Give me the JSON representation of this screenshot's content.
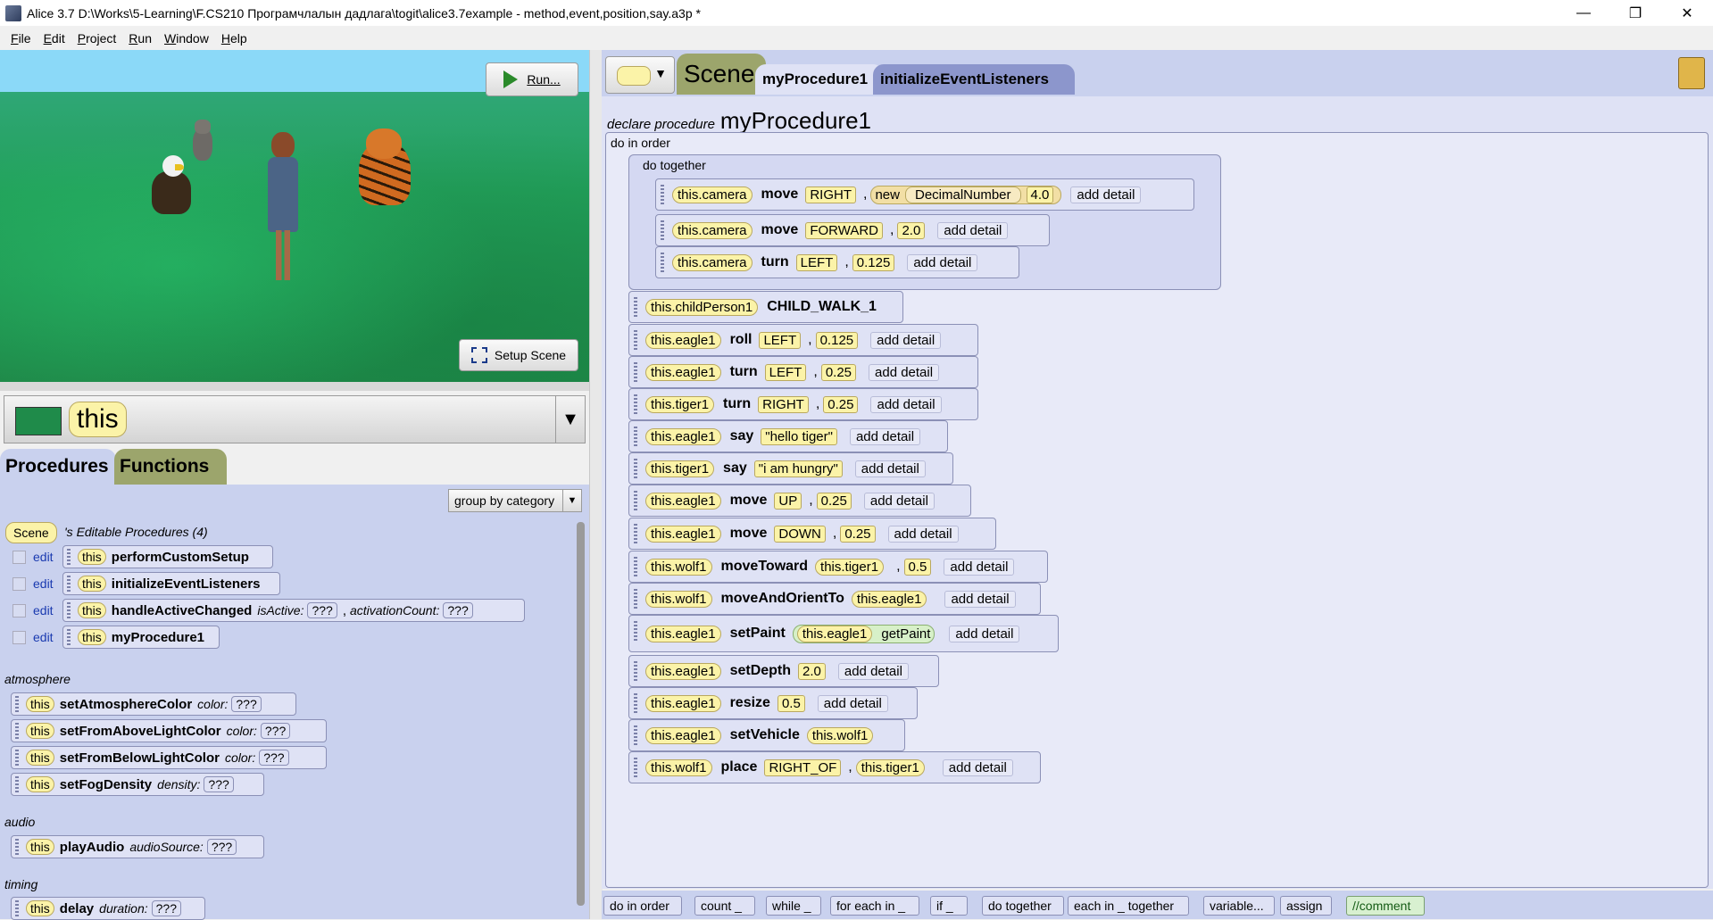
{
  "window": {
    "title": "Alice 3.7 D:\\Works\\5-Learning\\F.CS210 Програмчлалын дадлага\\togit\\alice3.7example - method,event,position,say.a3p *",
    "controls": [
      "—",
      "❐",
      "✕"
    ]
  },
  "menu": [
    "File",
    "Edit",
    "Project",
    "Run",
    "Window",
    "Help"
  ],
  "scene_view": {
    "run_label": "Run...",
    "setup_scene_label": "Setup Scene"
  },
  "instance_selector": {
    "value": "this"
  },
  "left_tabs": {
    "procedures": "Procedures",
    "functions": "Functions"
  },
  "group_by": "group by category",
  "editable": {
    "owner": "Scene",
    "caption": "'s Editable Procedures (4)",
    "edit_label": "edit",
    "this_label": "this",
    "unknown": "???",
    "items": [
      {
        "name": "performCustomSetup"
      },
      {
        "name": "initializeEventListeners"
      },
      {
        "name": "handleActiveChanged",
        "p1": "isActive:",
        "p2": "activationCount:"
      },
      {
        "name": "myProcedure1"
      }
    ]
  },
  "categories": {
    "atmosphere": {
      "label": "atmosphere",
      "items": [
        {
          "name": "setAtmosphereColor",
          "param": "color:"
        },
        {
          "name": "setFromAboveLightColor",
          "param": "color:"
        },
        {
          "name": "setFromBelowLightColor",
          "param": "color:"
        },
        {
          "name": "setFogDensity",
          "param": "density:"
        }
      ]
    },
    "audio": {
      "label": "audio",
      "items": [
        {
          "name": "playAudio",
          "param": "audioSource:"
        }
      ]
    },
    "timing": {
      "label": "timing",
      "items": [
        {
          "name": "delay",
          "param": "duration:"
        }
      ]
    }
  },
  "editor_tabs": {
    "scene": "Scene",
    "active": "myProcedure1",
    "other": "initializeEventListeners"
  },
  "declaration": {
    "keyword": "declare procedure",
    "name": "myProcedure1"
  },
  "code": {
    "do_in_order": "do in order",
    "do_together": "do together",
    "add_detail": "add detail",
    "together_stmts": [
      {
        "obj": "this.camera",
        "method": "move",
        "a1": "RIGHT",
        "new_kw": "new",
        "new_class": "DecimalNumber",
        "new_val": "4.0"
      },
      {
        "obj": "this.camera",
        "method": "move",
        "a1": "FORWARD",
        "a2": "2.0"
      },
      {
        "obj": "this.camera",
        "method": "turn",
        "a1": "LEFT",
        "a2": "0.125"
      }
    ],
    "stmts": [
      {
        "obj": "this.childPerson1",
        "method": "CHILD_WALK_1"
      },
      {
        "obj": "this.eagle1",
        "method": "roll",
        "a1": "LEFT",
        "a2": "0.125"
      },
      {
        "obj": "this.eagle1",
        "method": "turn",
        "a1": "LEFT",
        "a2": "0.25"
      },
      {
        "obj": "this.tiger1",
        "method": "turn",
        "a1": "RIGHT",
        "a2": "0.25"
      },
      {
        "obj": "this.eagle1",
        "method": "say",
        "a1": "\"hello tiger\""
      },
      {
        "obj": "this.tiger1",
        "method": "say",
        "a1": "\"i am hungry\""
      },
      {
        "obj": "this.eagle1",
        "method": "move",
        "a1": "UP",
        "a2": "0.25"
      },
      {
        "obj": "this.eagle1",
        "method": "move",
        "a1": "DOWN",
        "a2": "0.25"
      },
      {
        "obj": "this.wolf1",
        "method": "moveToward",
        "a1": "this.tiger1",
        "a2": "0.5"
      },
      {
        "obj": "this.wolf1",
        "method": "moveAndOrientTo",
        "a1": "this.eagle1"
      },
      {
        "obj": "this.eagle1",
        "method": "setPaint",
        "a1": "this.eagle1",
        "a2": "getPaint"
      },
      {
        "obj": "this.eagle1",
        "method": "setDepth",
        "a1": "2.0"
      },
      {
        "obj": "this.eagle1",
        "method": "resize",
        "a1": "0.5"
      },
      {
        "obj": "this.eagle1",
        "method": "setVehicle",
        "a1": "this.wolf1"
      },
      {
        "obj": "this.wolf1",
        "method": "place",
        "a1": "RIGHT_OF",
        "a2": "this.tiger1"
      }
    ]
  },
  "control_bar": [
    "do in order",
    "count _",
    "while _",
    "for each in _",
    "if _",
    "do together",
    "each in _ together",
    "variable...",
    "assign",
    "//comment"
  ]
}
